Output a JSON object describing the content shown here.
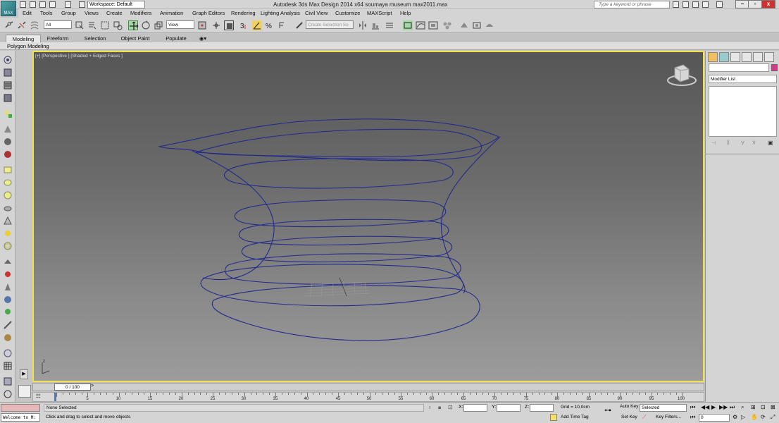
{
  "titlebar": {
    "logo_text": "MAX",
    "workspace": "Workspace: Default",
    "title": "Autodesk 3ds Max Design 2014 x64     soumaya museum max2011.max",
    "search_placeholder": "Type a keyword or phrase"
  },
  "menu": [
    "Edit",
    "Tools",
    "Group",
    "Views",
    "Create",
    "Modifiers",
    "Animation",
    "Graph Editors",
    "Rendering",
    "Lighting Analysis",
    "Civil View",
    "Customize",
    "MAXScript",
    "Help"
  ],
  "toolbar": {
    "selection_filter": "All",
    "ref_coord": "View",
    "named_selection": "Create Selection Se"
  },
  "ribbon": {
    "tabs": [
      "Modeling",
      "Freeform",
      "Selection",
      "Object Paint",
      "Populate"
    ],
    "active_tab": "Modeling",
    "panel_label": "Polygon Modeling"
  },
  "viewport": {
    "label": "[+] [Perspective ] [Shaded + Edged Faces ]",
    "curve_color": "#232a8c",
    "border_color": "#f1e04b"
  },
  "command_panel": {
    "modifier_list": "Modifier List",
    "object_color": "#d43a87"
  },
  "timeline": {
    "current": "0 / 100",
    "ticks": [
      "5",
      "10",
      "15",
      "20",
      "25",
      "30",
      "35",
      "40",
      "45",
      "50",
      "55",
      "60",
      "65",
      "70",
      "75",
      "80",
      "85",
      "90",
      "95",
      "100"
    ]
  },
  "status": {
    "maxscript_output": "Welcome to M:",
    "selection": "None Selected",
    "prompt": "Click and drag to select and move objects",
    "x_label": "X:",
    "y_label": "Y:",
    "z_label": "Z:",
    "grid": "Grid = 10,0cm",
    "add_time_tag": "Add Time Tag",
    "auto_key": "Auto Key",
    "set_key": "Set Key",
    "selected_option": "Selected",
    "key_filters": "Key Filters...",
    "frame": "0"
  }
}
